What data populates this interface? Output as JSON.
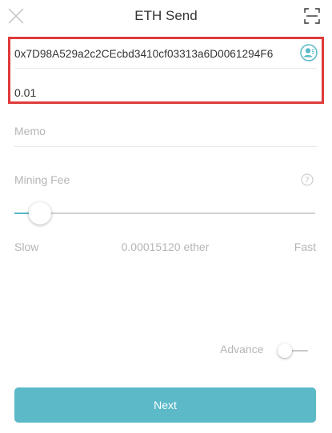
{
  "header": {
    "title": "ETH Send",
    "close_icon": "close-icon",
    "scan_icon": "scan-icon"
  },
  "form": {
    "address_value": "0x7D98A529a2c2CEcbd3410cf03313a6D0061294F6",
    "contact_icon": "contact-icon",
    "amount_value": "0.01",
    "memo_placeholder": "Memo"
  },
  "fee": {
    "label": "Mining Fee",
    "help_icon": "help-icon",
    "slider_level": 0.05,
    "slow_label": "Slow",
    "value_text": "0.00015120 ether",
    "fast_label": "Fast"
  },
  "advance": {
    "label": "Advance",
    "enabled": false
  },
  "actions": {
    "next_label": "Next"
  },
  "colors": {
    "accent": "#5bb9c8",
    "highlight_border": "#e03a3a",
    "placeholder": "#b5b5b5"
  }
}
